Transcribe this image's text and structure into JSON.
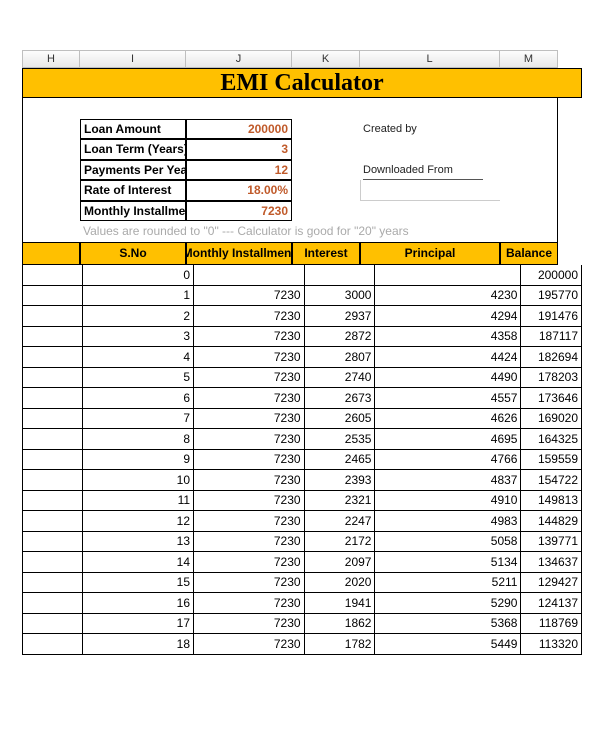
{
  "columns": [
    "H",
    "I",
    "J",
    "K",
    "L",
    "M"
  ],
  "title": "EMI Calculator",
  "inputs": {
    "loan_amount_label": "Loan Amount",
    "loan_amount_value": "200000",
    "loan_term_label": "Loan Term (Years)",
    "loan_term_value": "3",
    "payments_per_year_label": "Payments Per Year",
    "payments_per_year_value": "12",
    "rate_label": "Rate of Interest",
    "rate_value": "18.00%",
    "monthly_installment_label": "Monthly Installment",
    "monthly_installment_value": "7230"
  },
  "meta": {
    "created_by_label": "Created by",
    "downloaded_from_label": "Downloaded From"
  },
  "note": "Values are rounded to \"0\"  ---  Calculator is good for \"20\" years",
  "table_headers": {
    "sno": "S.No",
    "installment": "Monthly Installment",
    "interest": "Interest",
    "principal": "Principal",
    "balance": "Balance"
  },
  "rows": [
    {
      "sno": "0",
      "inst": "",
      "int": "",
      "prin": "",
      "bal": "200000"
    },
    {
      "sno": "1",
      "inst": "7230",
      "int": "3000",
      "prin": "4230",
      "bal": "195770"
    },
    {
      "sno": "2",
      "inst": "7230",
      "int": "2937",
      "prin": "4294",
      "bal": "191476"
    },
    {
      "sno": "3",
      "inst": "7230",
      "int": "2872",
      "prin": "4358",
      "bal": "187117"
    },
    {
      "sno": "4",
      "inst": "7230",
      "int": "2807",
      "prin": "4424",
      "bal": "182694"
    },
    {
      "sno": "5",
      "inst": "7230",
      "int": "2740",
      "prin": "4490",
      "bal": "178203"
    },
    {
      "sno": "6",
      "inst": "7230",
      "int": "2673",
      "prin": "4557",
      "bal": "173646"
    },
    {
      "sno": "7",
      "inst": "7230",
      "int": "2605",
      "prin": "4626",
      "bal": "169020"
    },
    {
      "sno": "8",
      "inst": "7230",
      "int": "2535",
      "prin": "4695",
      "bal": "164325"
    },
    {
      "sno": "9",
      "inst": "7230",
      "int": "2465",
      "prin": "4766",
      "bal": "159559"
    },
    {
      "sno": "10",
      "inst": "7230",
      "int": "2393",
      "prin": "4837",
      "bal": "154722"
    },
    {
      "sno": "11",
      "inst": "7230",
      "int": "2321",
      "prin": "4910",
      "bal": "149813"
    },
    {
      "sno": "12",
      "inst": "7230",
      "int": "2247",
      "prin": "4983",
      "bal": "144829"
    },
    {
      "sno": "13",
      "inst": "7230",
      "int": "2172",
      "prin": "5058",
      "bal": "139771"
    },
    {
      "sno": "14",
      "inst": "7230",
      "int": "2097",
      "prin": "5134",
      "bal": "134637"
    },
    {
      "sno": "15",
      "inst": "7230",
      "int": "2020",
      "prin": "5211",
      "bal": "129427"
    },
    {
      "sno": "16",
      "inst": "7230",
      "int": "1941",
      "prin": "5290",
      "bal": "124137"
    },
    {
      "sno": "17",
      "inst": "7230",
      "int": "1862",
      "prin": "5368",
      "bal": "118769"
    },
    {
      "sno": "18",
      "inst": "7230",
      "int": "1782",
      "prin": "5449",
      "bal": "113320"
    }
  ]
}
